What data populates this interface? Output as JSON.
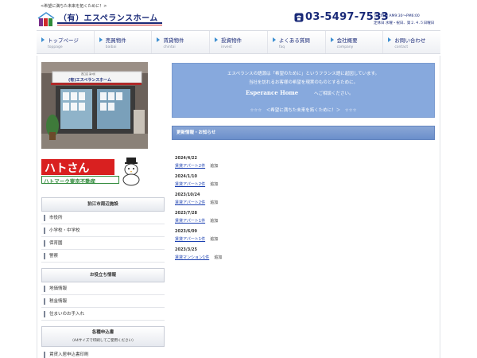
{
  "header": {
    "tagline": "<希望に満ちた未来を拓くために！>",
    "company_name": "（有）エスペランスホーム",
    "phone": "03-5497-7533",
    "hours_line1": "営業時間 AM9:30〜PM6:00",
    "hours_line2": "定休日 水曜・祝日、第２.４.５日曜日"
  },
  "nav": [
    {
      "label": "トップページ",
      "sub": "toppage"
    },
    {
      "label": "売買物件",
      "sub": "baibai"
    },
    {
      "label": "賃貸物件",
      "sub": "chintai"
    },
    {
      "label": "投資物件",
      "sub": "invest"
    },
    {
      "label": "よくある質問",
      "sub": "faq"
    },
    {
      "label": "会社概要",
      "sub": "company"
    },
    {
      "label": "お問い合わせ",
      "sub": "contact"
    }
  ],
  "sidebar": {
    "store_sign": "(有)エスペランスホーム",
    "store_sign_small": "西口店 第3仮",
    "hato_banner_title": "ハトさん",
    "hato_banner_sub": "ハトマーク東京不動産",
    "section1_title": "狛江市周辺施設",
    "section1_links": [
      "市役所",
      "小学校・中学校",
      "保育園",
      "警察"
    ],
    "section2_title": "お役立ち情報",
    "section2_links": [
      "地価情報",
      "税金情報",
      "住まいのお手入れ"
    ],
    "section3_title": "各種申込書",
    "section3_note": "（A4サイズで印刷してご使用ください）",
    "section3_links": [
      "賃貸入居申込書印刷"
    ]
  },
  "intro": {
    "line1": "エスペランスの語源は「希望のために」というフランス語に起因しています。",
    "line2": "当社を訪れるお客様の希望を現実のものとするために。",
    "brand": "Esperance Home",
    "brand_tail": "へご相談ください。",
    "line4": "☆☆☆　＜希望に満ちた未来を拓くために！＞　☆☆☆"
  },
  "news": {
    "title": "更新情報・お知らせ",
    "items": [
      {
        "date": "2024/4/22",
        "link": "賃貸アパート2件",
        "note": "追加"
      },
      {
        "date": "2024/1/10",
        "link": "賃貸アパート2件",
        "note": "追加"
      },
      {
        "date": "2023/10/24",
        "link": "賃貸アパート2件",
        "note": "追加"
      },
      {
        "date": "2023/7/28",
        "link": "賃貸アパート1件",
        "note": "追加"
      },
      {
        "date": "2023/6/09",
        "link": "賃貸アパート1件",
        "note": "追加"
      },
      {
        "date": "2023/3/25",
        "link": "賃貸マンション1件",
        "note": "追加"
      }
    ]
  },
  "colors": {
    "brand_navy": "#1a2a78",
    "accent_red": "#d02a2a",
    "intro_blue": "#87a9dd",
    "news_head_blue": "#6b8fcb",
    "link_blue": "#1a3fb0"
  },
  "icons": {
    "logo": "house-logo-icon",
    "phone": "phone-icon",
    "nav_bullet": "triangle-right-icon"
  }
}
